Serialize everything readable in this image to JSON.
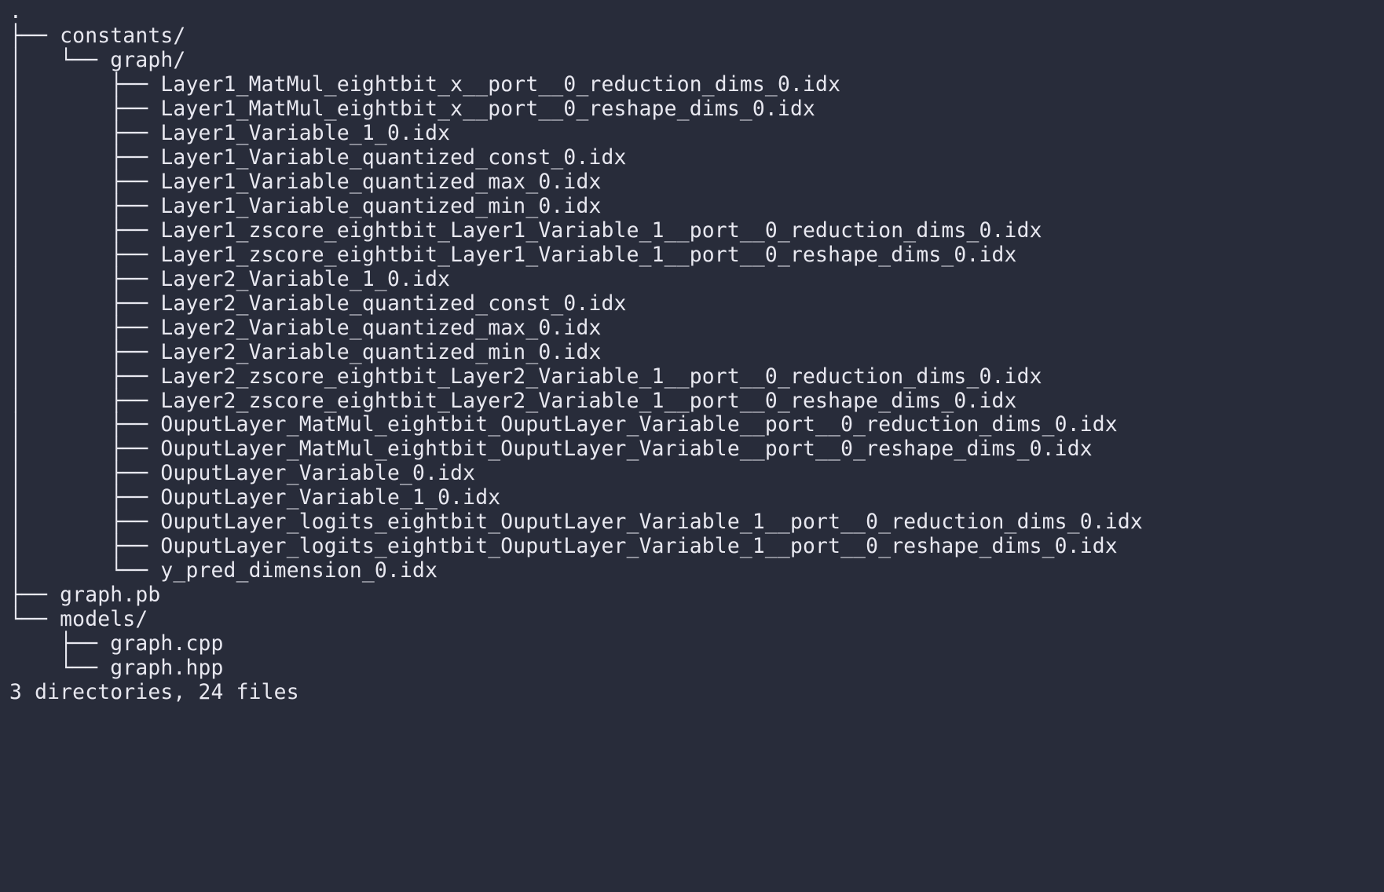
{
  "root": ".",
  "tree": [
    {
      "prefix": "├── ",
      "name": "constants/"
    },
    {
      "prefix": "│   └── ",
      "name": "graph/"
    },
    {
      "prefix": "│       ├── ",
      "name": "Layer1_MatMul_eightbit_x__port__0_reduction_dims_0.idx"
    },
    {
      "prefix": "│       ├── ",
      "name": "Layer1_MatMul_eightbit_x__port__0_reshape_dims_0.idx"
    },
    {
      "prefix": "│       ├── ",
      "name": "Layer1_Variable_1_0.idx"
    },
    {
      "prefix": "│       ├── ",
      "name": "Layer1_Variable_quantized_const_0.idx"
    },
    {
      "prefix": "│       ├── ",
      "name": "Layer1_Variable_quantized_max_0.idx"
    },
    {
      "prefix": "│       ├── ",
      "name": "Layer1_Variable_quantized_min_0.idx"
    },
    {
      "prefix": "│       ├── ",
      "name": "Layer1_zscore_eightbit_Layer1_Variable_1__port__0_reduction_dims_0.idx"
    },
    {
      "prefix": "│       ├── ",
      "name": "Layer1_zscore_eightbit_Layer1_Variable_1__port__0_reshape_dims_0.idx"
    },
    {
      "prefix": "│       ├── ",
      "name": "Layer2_Variable_1_0.idx"
    },
    {
      "prefix": "│       ├── ",
      "name": "Layer2_Variable_quantized_const_0.idx"
    },
    {
      "prefix": "│       ├── ",
      "name": "Layer2_Variable_quantized_max_0.idx"
    },
    {
      "prefix": "│       ├── ",
      "name": "Layer2_Variable_quantized_min_0.idx"
    },
    {
      "prefix": "│       ├── ",
      "name": "Layer2_zscore_eightbit_Layer2_Variable_1__port__0_reduction_dims_0.idx"
    },
    {
      "prefix": "│       ├── ",
      "name": "Layer2_zscore_eightbit_Layer2_Variable_1__port__0_reshape_dims_0.idx"
    },
    {
      "prefix": "│       ├── ",
      "name": "OuputLayer_MatMul_eightbit_OuputLayer_Variable__port__0_reduction_dims_0.idx"
    },
    {
      "prefix": "│       ├── ",
      "name": "OuputLayer_MatMul_eightbit_OuputLayer_Variable__port__0_reshape_dims_0.idx"
    },
    {
      "prefix": "│       ├── ",
      "name": "OuputLayer_Variable_0.idx"
    },
    {
      "prefix": "│       ├── ",
      "name": "OuputLayer_Variable_1_0.idx"
    },
    {
      "prefix": "│       ├── ",
      "name": "OuputLayer_logits_eightbit_OuputLayer_Variable_1__port__0_reduction_dims_0.idx"
    },
    {
      "prefix": "│       ├── ",
      "name": "OuputLayer_logits_eightbit_OuputLayer_Variable_1__port__0_reshape_dims_0.idx"
    },
    {
      "prefix": "│       └── ",
      "name": "y_pred_dimension_0.idx"
    },
    {
      "prefix": "├── ",
      "name": "graph.pb"
    },
    {
      "prefix": "└── ",
      "name": "models/"
    },
    {
      "prefix": "    ├── ",
      "name": "graph.cpp"
    },
    {
      "prefix": "    └── ",
      "name": "graph.hpp"
    }
  ],
  "summary": "3 directories, 24 files"
}
